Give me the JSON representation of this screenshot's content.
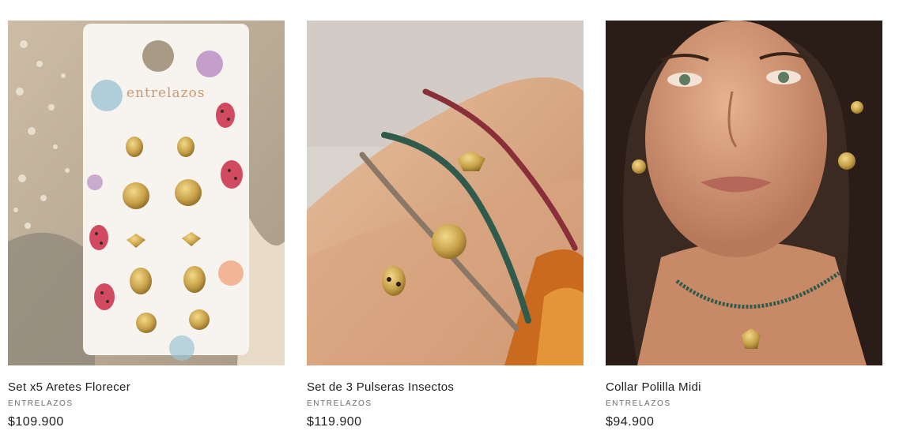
{
  "products": [
    {
      "title": "Set x5 Aretes Florecer",
      "vendor": "ENTRELAZOS",
      "price": "$109.900",
      "image_card_text": "entrelazos"
    },
    {
      "title": "Set de 3 Pulseras Insectos",
      "vendor": "ENTRELAZOS",
      "price": "$119.900"
    },
    {
      "title": "Collar Polilla Midi",
      "vendor": "ENTRELAZOS",
      "price": "$94.900"
    }
  ],
  "colors": {
    "gold": "#c9a24a",
    "ruby_beads": "#8a2f3a",
    "emerald_beads": "#2f5a4c",
    "smoky_beads": "#8a7766"
  }
}
